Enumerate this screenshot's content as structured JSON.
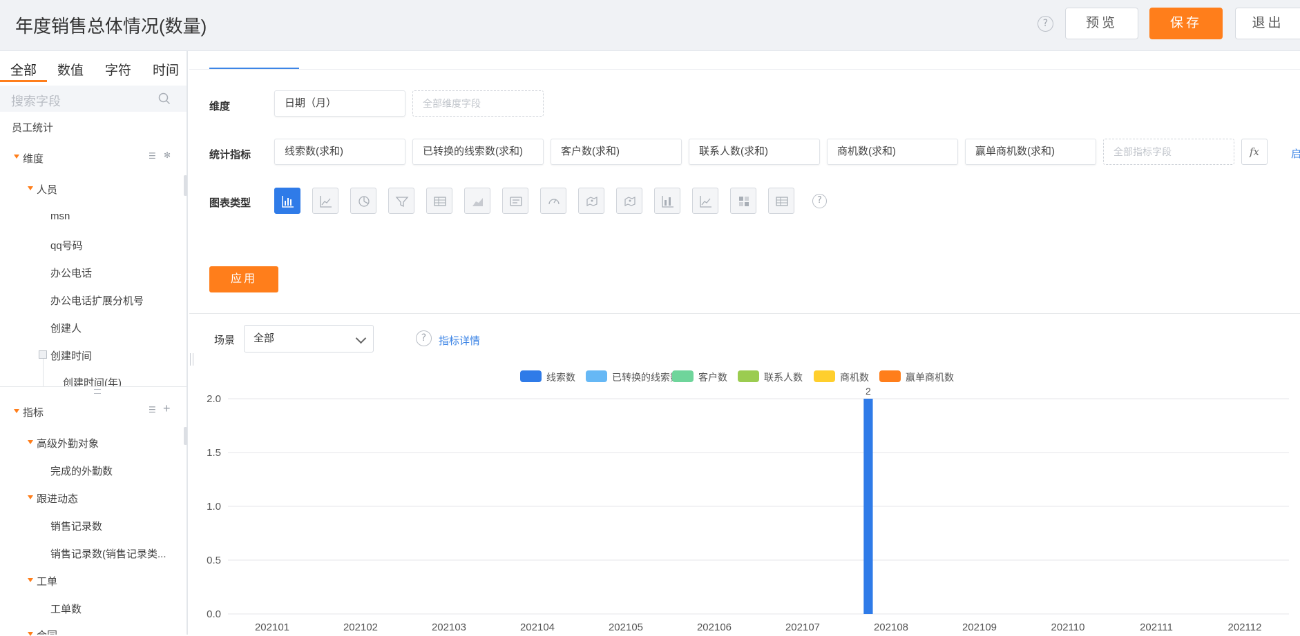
{
  "header": {
    "title": "年度销售总体情况(数量)",
    "help_symbol": "?",
    "buttons": {
      "preview": "预览",
      "save": "保存",
      "exit": "退出"
    }
  },
  "sidebar": {
    "tabs": [
      "全部",
      "数值",
      "字符",
      "时间"
    ],
    "search_placeholder": "搜索字段",
    "group_title": "员工统计",
    "dimension": {
      "label": "维度",
      "sub_group": "人员",
      "fields": [
        "msn",
        "qq号码",
        "办公电话",
        "办公电话扩展分机号",
        "创建人"
      ],
      "time_group": "创建时间",
      "time_child": "创建时间(年)"
    },
    "metric": {
      "label": "指标",
      "groups": [
        {
          "name": "高级外勤对象",
          "fields": [
            "完成的外勤数"
          ]
        },
        {
          "name": "跟进动态",
          "fields": [
            "销售记录数",
            "销售记录数(销售记录类..."
          ]
        },
        {
          "name": "工单",
          "fields": [
            "工单数"
          ]
        },
        {
          "name": "合同",
          "fields": []
        }
      ]
    }
  },
  "config": {
    "dimension_label": "维度",
    "dimension_chip": "日期（月）",
    "dimension_placeholder": "全部维度字段",
    "metric_label": "统计指标",
    "metric_chips": [
      "线索数(求和)",
      "已转换的线索数(求和)",
      "客户数(求和)",
      "联系人数(求和)",
      "商机数(求和)",
      "赢单商机数(求和)"
    ],
    "metric_placeholder": "全部指标字段",
    "fx_label": "fx",
    "cut_link": "启",
    "chart_type_label": "图表类型",
    "chart_types": [
      "bar-chart-icon",
      "line-chart-icon",
      "pie-chart-icon",
      "funnel-chart-icon",
      "table-chart-icon",
      "area-chart-icon",
      "card-chart-icon",
      "gauge-chart-icon",
      "map-chart-icon",
      "scatter-map-icon",
      "stacked-bar-icon",
      "dual-axis-line-icon",
      "heatmap-chart-icon",
      "pivot-table-icon"
    ],
    "chart_type_help": "?",
    "apply_button": "应用"
  },
  "scene": {
    "label": "场景",
    "selected": "全部",
    "detail_link": "指标详情",
    "help_symbol": "?"
  },
  "chart_data": {
    "type": "bar",
    "categories": [
      "202101",
      "202102",
      "202103",
      "202104",
      "202105",
      "202106",
      "202107",
      "202108",
      "202109",
      "202110",
      "202111",
      "202112"
    ],
    "series": [
      {
        "name": "线索数",
        "color": "#2f7be8",
        "values": [
          0,
          0,
          0,
          0,
          0,
          0,
          0,
          2,
          0,
          0,
          0,
          0
        ]
      },
      {
        "name": "已转换的线索数",
        "color": "#66b8f5",
        "values": [
          0,
          0,
          0,
          0,
          0,
          0,
          0,
          0,
          0,
          0,
          0,
          0
        ]
      },
      {
        "name": "客户数",
        "color": "#6fd59b",
        "values": [
          0,
          0,
          0,
          0,
          0,
          0,
          0,
          0,
          0,
          0,
          0,
          0
        ]
      },
      {
        "name": "联系人数",
        "color": "#9bcc50",
        "values": [
          0,
          0,
          0,
          0,
          0,
          0,
          0,
          0,
          0,
          0,
          0,
          0
        ]
      },
      {
        "name": "商机数",
        "color": "#ffcf2d",
        "values": [
          0,
          0,
          0,
          0,
          0,
          0,
          0,
          0,
          0,
          0,
          0,
          0
        ]
      },
      {
        "name": "赢单商机数",
        "color": "#ff7e1b",
        "values": [
          0,
          0,
          0,
          0,
          0,
          0,
          0,
          0,
          0,
          0,
          0,
          0
        ]
      }
    ],
    "yticks": [
      "0.0",
      "0.5",
      "1.0",
      "1.5",
      "2.0"
    ],
    "ylim": [
      0,
      2
    ],
    "data_labels": {
      "7": "2"
    },
    "grid": true,
    "legend": "top-center",
    "colors": {
      "accent": "#ff7e1b",
      "primary_blue": "#2f7be8"
    }
  }
}
